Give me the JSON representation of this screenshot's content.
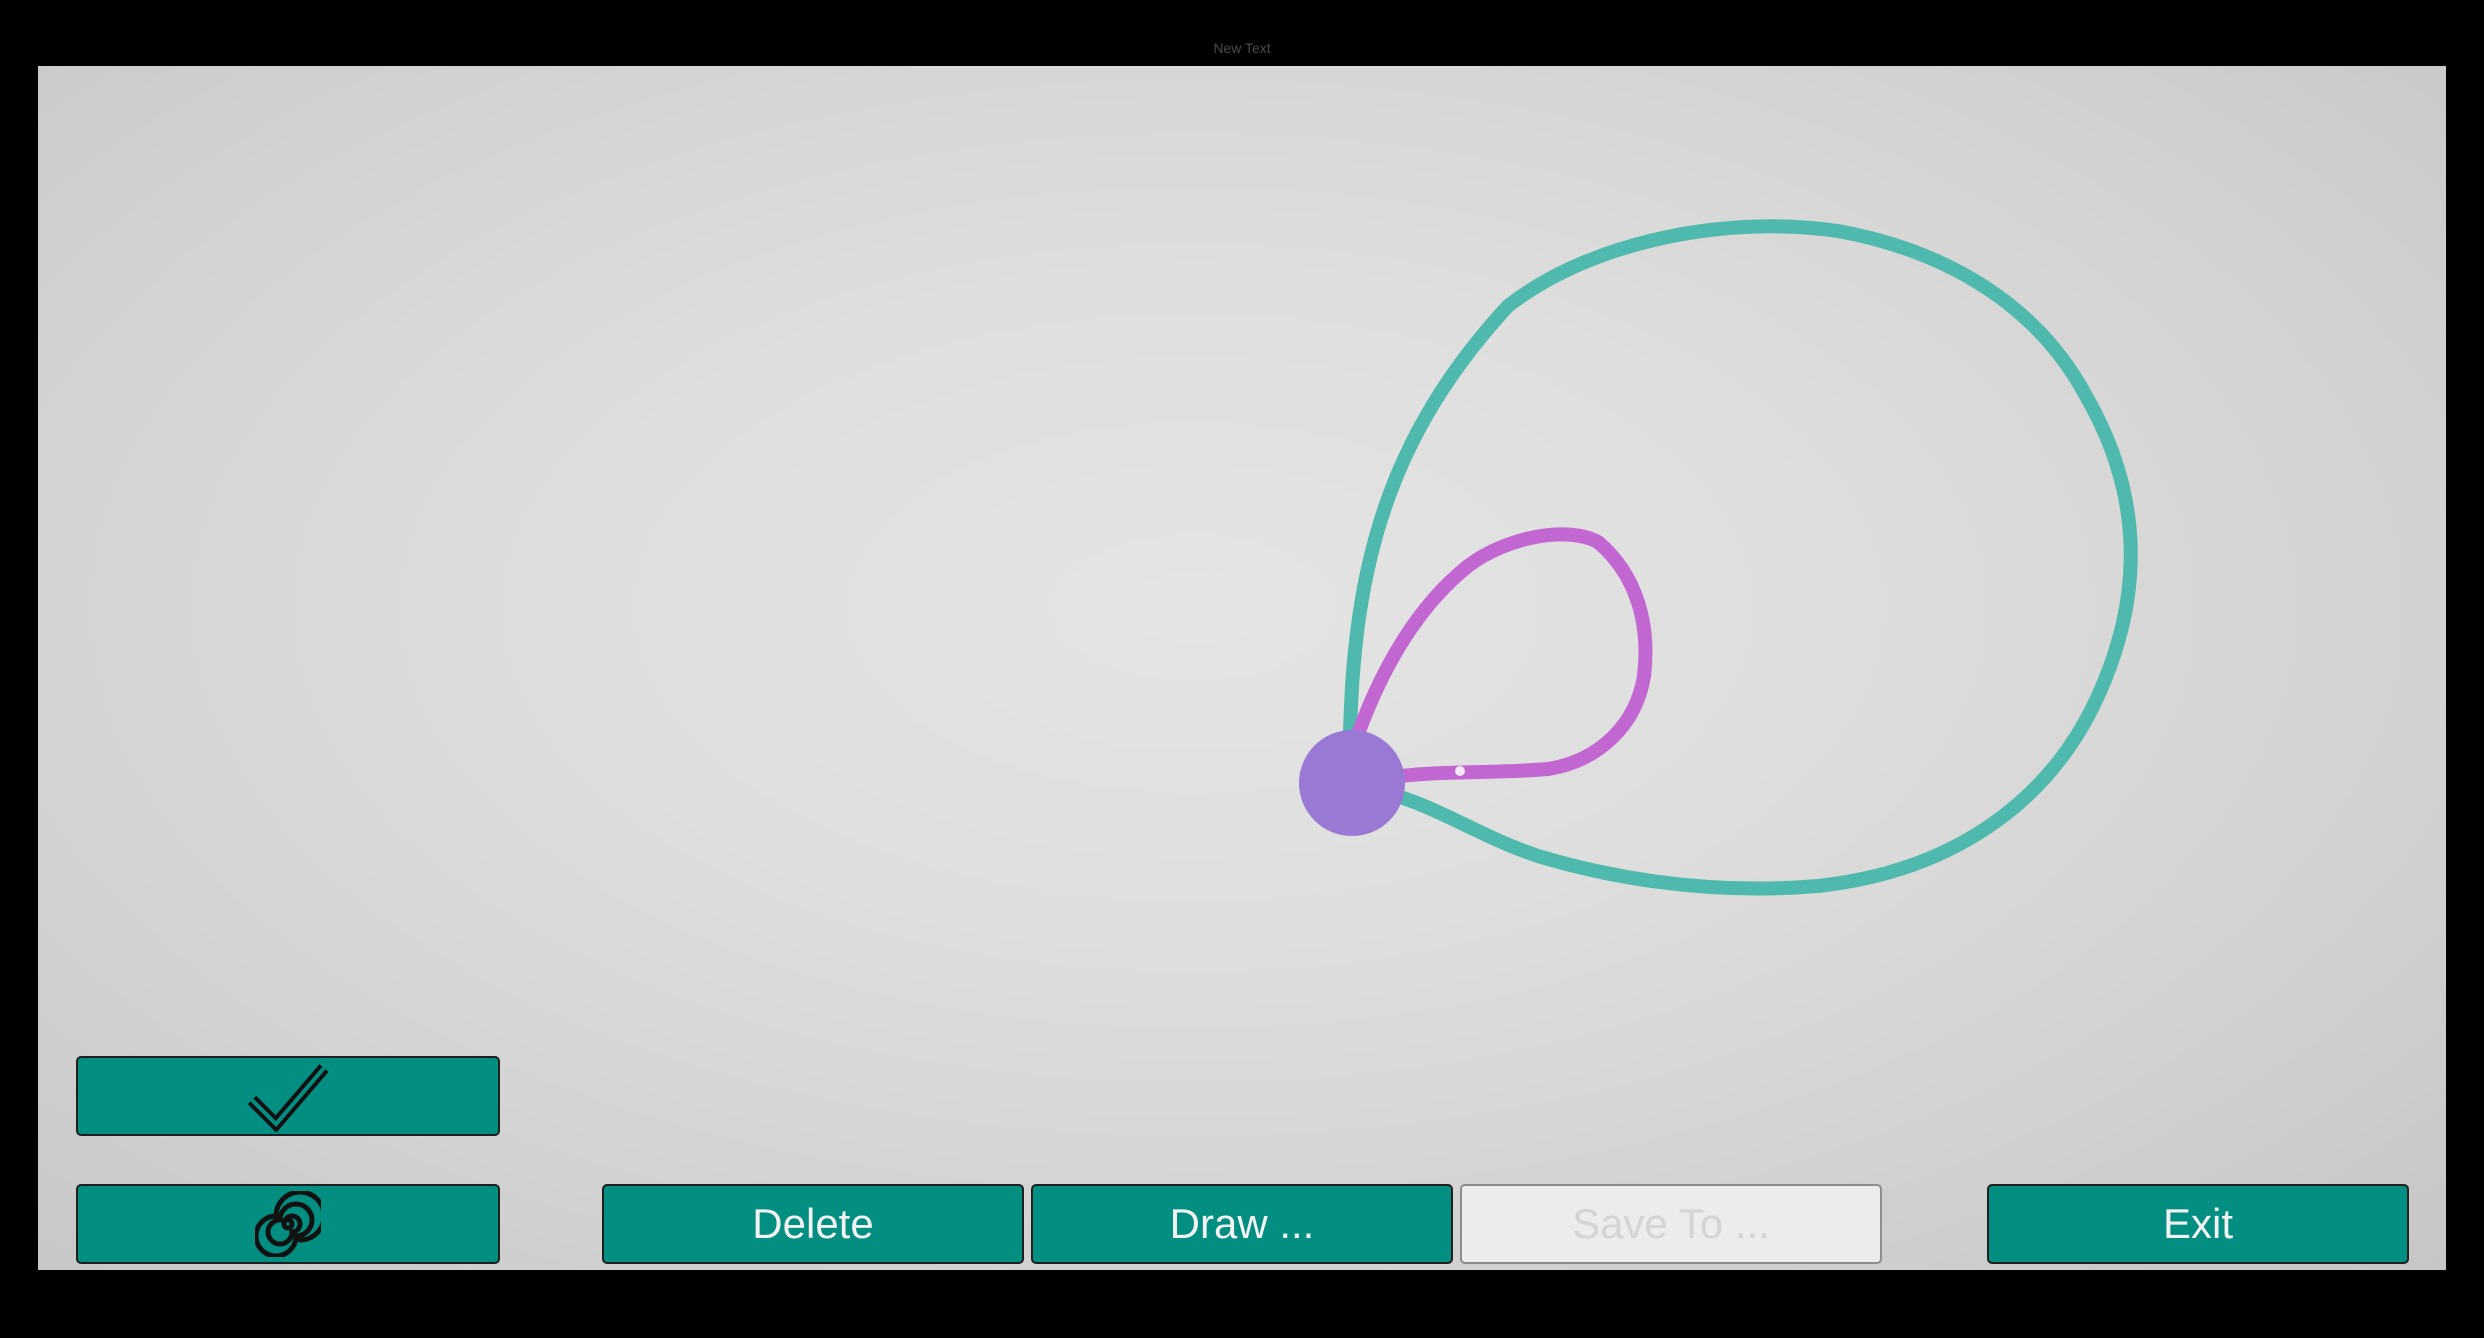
{
  "caption": "New Text",
  "colors": {
    "accent": "#028e80",
    "outer_curve": "#4fb9ae",
    "inner_curve": "#c267d2",
    "node": "#9a79d4",
    "disabled_bg": "#ececec"
  },
  "tools": {
    "confirm": {
      "icon": "checkmark-icon"
    },
    "spiral": {
      "icon": "spiral-icon"
    }
  },
  "actions": {
    "delete_label": "Delete",
    "draw_label": "Draw ...",
    "save_label": "Save To ...",
    "exit_label": "Exit"
  }
}
